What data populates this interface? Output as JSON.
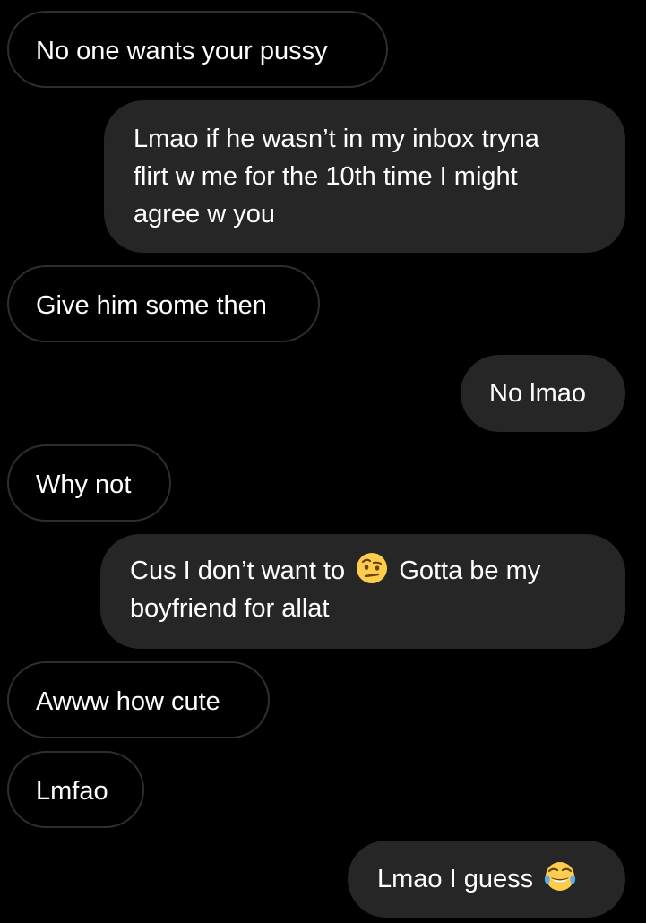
{
  "conversation": {
    "messages": [
      {
        "direction": "received",
        "lines": [
          "No one wants your pussy"
        ]
      },
      {
        "direction": "sent",
        "lines": [
          "Lmao if he wasn’t in my inbox tryna",
          "flirt w me for the 10th time I might",
          "agree w you"
        ]
      },
      {
        "direction": "received",
        "lines": [
          "Give him some then"
        ]
      },
      {
        "direction": "sent",
        "lines": [
          "No lmao"
        ]
      },
      {
        "direction": "received",
        "lines": [
          "Why not"
        ]
      },
      {
        "direction": "sent",
        "lines": [
          "Cus I don’t want to",
          "Gotta be my",
          "boyfriend for allat"
        ],
        "emoji": "face-with-raised-eyebrow"
      },
      {
        "direction": "received",
        "lines": [
          "Awww how cute"
        ]
      },
      {
        "direction": "received",
        "lines": [
          "Lmfao"
        ]
      },
      {
        "direction": "sent",
        "lines": [
          "Lmao I guess"
        ],
        "emoji": "face-with-tears-of-joy"
      }
    ]
  },
  "colors": {
    "background": "#000000",
    "sent_bubble": "#262626",
    "received_border": "#2e2e2e",
    "text": "#ffffff"
  }
}
